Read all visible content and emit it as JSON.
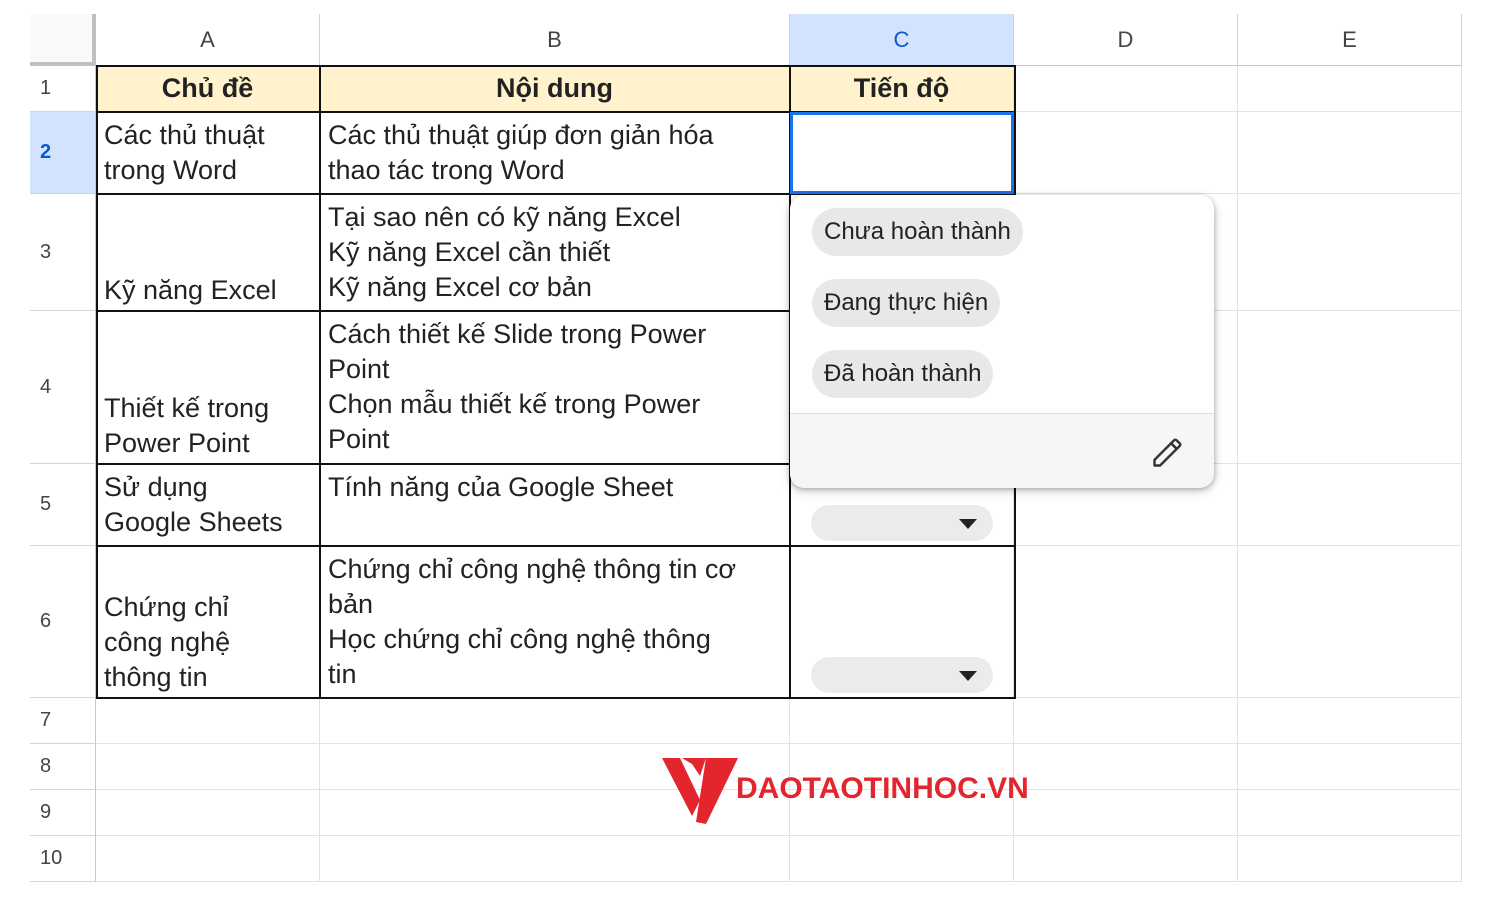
{
  "columns": [
    "A",
    "B",
    "C",
    "D",
    "E"
  ],
  "rows": [
    "1",
    "2",
    "3",
    "4",
    "5",
    "6",
    "7",
    "8",
    "9",
    "10"
  ],
  "headers": {
    "topic": "Chủ đề",
    "content": "Nội dung",
    "progress": "Tiến độ"
  },
  "table": [
    {
      "topic": [
        "Các thủ thuật",
        "trong Word"
      ],
      "content": [
        "Các thủ thuật giúp đơn giản hóa",
        "thao tác trong Word"
      ]
    },
    {
      "topic": [
        "Kỹ năng Excel"
      ],
      "content": [
        "Tại sao nên có kỹ năng Excel",
        "Kỹ năng Excel cần thiết",
        "Kỹ năng Excel cơ bản"
      ]
    },
    {
      "topic": [
        "Thiết kế trong",
        "Power Point"
      ],
      "content": [
        "Cách thiết kế Slide trong Power",
        "Point",
        "Chọn mẫu thiết kế trong Power",
        "Point"
      ]
    },
    {
      "topic": [
        "Sử dụng",
        "Google Sheets"
      ],
      "content": [
        "Tính năng của Google Sheet"
      ]
    },
    {
      "topic": [
        "Chứng chỉ",
        "công nghệ",
        "thông tin"
      ],
      "content": [
        "Chứng chỉ công nghệ thông tin cơ",
        "bản",
        "Học chứng chỉ công nghệ thông",
        "tin"
      ]
    }
  ],
  "dropdown": {
    "options": [
      "Chưa hoàn thành",
      "Đang thực hiện",
      "Đã hoàn thành"
    ]
  },
  "selected_cell": "C2",
  "watermark": {
    "text": "DAOTAOTINHOC.VN",
    "color": "#e3262e"
  },
  "colors": {
    "header_fill": "#fff2cc",
    "selection": "#1a73e8",
    "selected_header": "#d3e3fd"
  },
  "icons": {
    "edit": "pencil-icon",
    "dropdown_arrow": "triangle-down-icon"
  }
}
